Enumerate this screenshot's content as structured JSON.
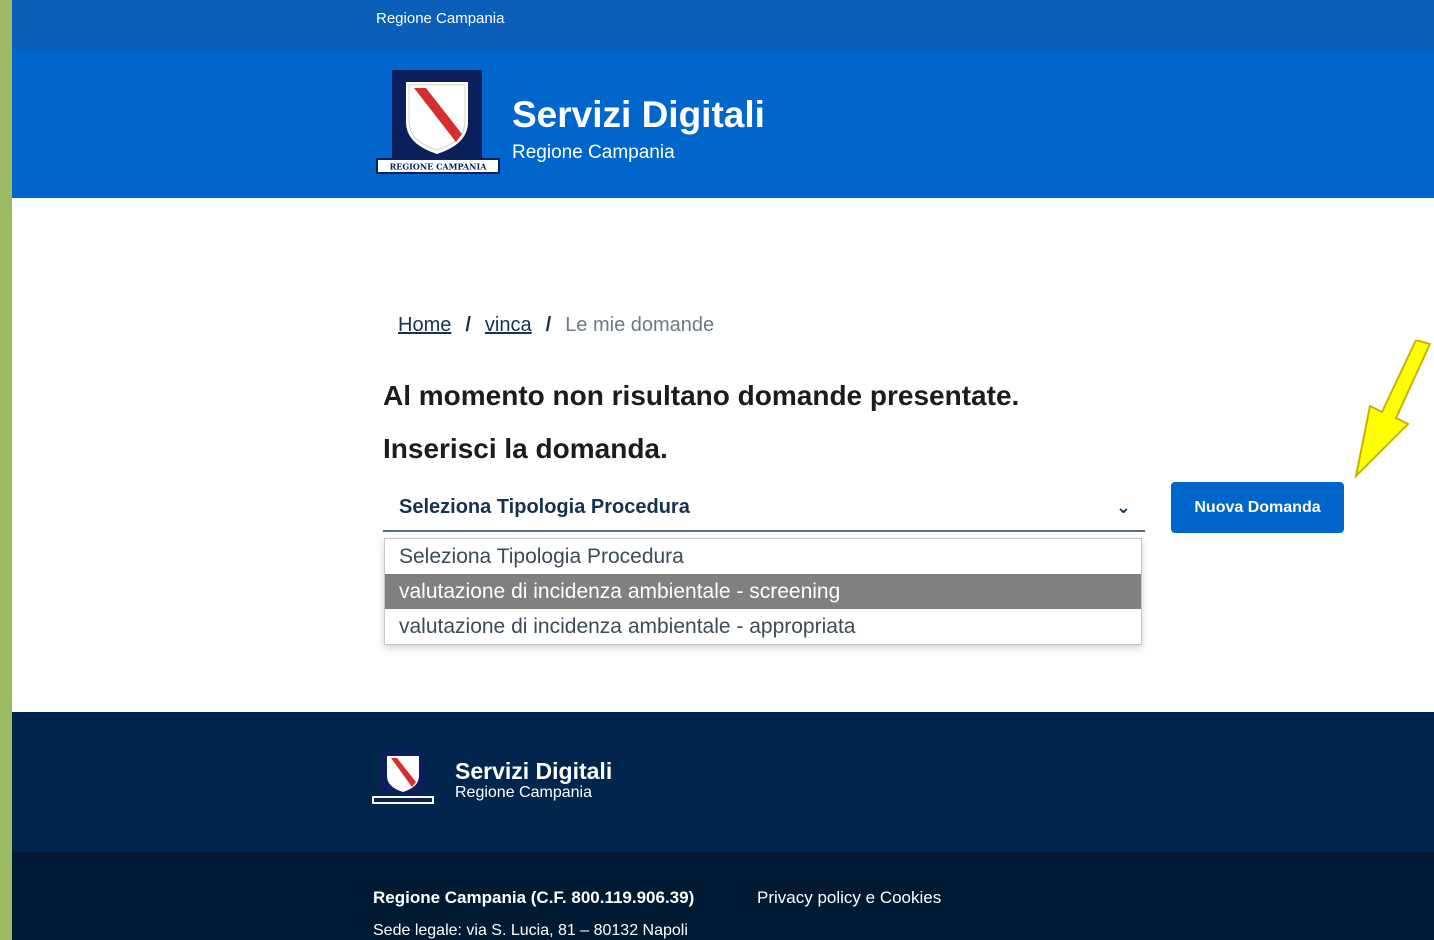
{
  "slim_header": {
    "label": "Regione Campania"
  },
  "brand": {
    "title": "Servizi Digitali",
    "subtitle": "Regione Campania",
    "logo_text": "REGIONE CAMPANIA"
  },
  "breadcrumb": {
    "items": [
      "Home",
      "vinca"
    ],
    "separator": "/",
    "current": "Le mie domande"
  },
  "messages": {
    "no_applications": "Al momento non risultano domande presentate.",
    "insert": "Inserisci la domanda."
  },
  "select": {
    "selected": "Seleziona Tipologia Procedura",
    "options": [
      "Seleziona Tipologia Procedura",
      "valutazione di incidenza ambientale - screening",
      "valutazione di incidenza ambientale - appropriata"
    ],
    "highlighted_index": 1
  },
  "button": {
    "label": "Nuova Domanda"
  },
  "footer": {
    "title": "Servizi Digitali",
    "subtitle": "Regione Campania",
    "entity": "Regione Campania (C.F. 800.119.906.39)",
    "address": "Sede legale: via S. Lucia, 81 – 80132 Napoli",
    "privacy_link": "Privacy policy e Cookies"
  },
  "colors": {
    "primary": "#0066cc",
    "footer_dark": "#00264d",
    "footer_darker": "#001a33",
    "highlight_arrow": "#ffff00"
  }
}
